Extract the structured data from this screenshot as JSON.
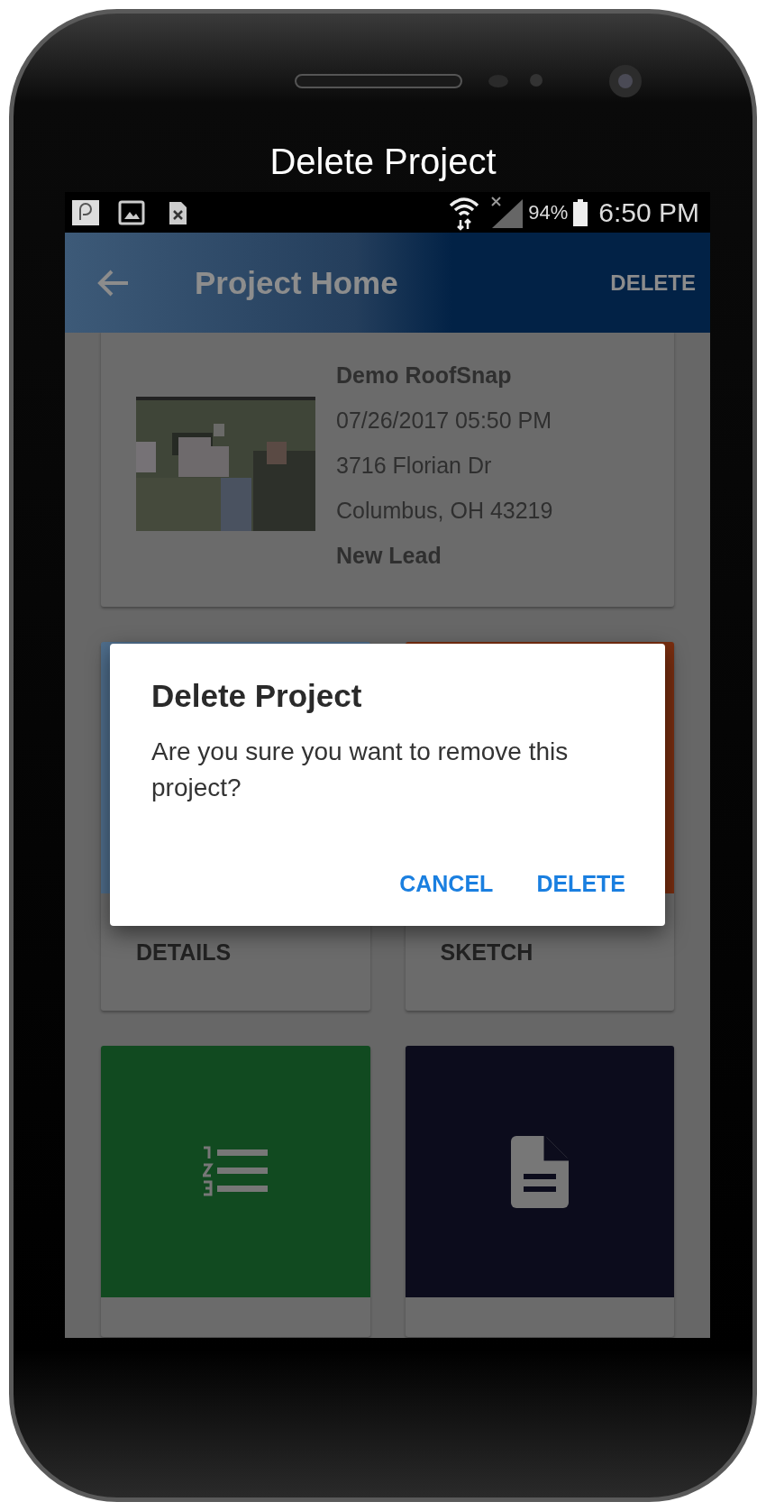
{
  "caption": "Delete Project",
  "status_bar": {
    "battery": "94%",
    "time": "6:50 PM"
  },
  "app_bar": {
    "title": "Project Home",
    "action": "DELETE"
  },
  "project": {
    "name": "Demo RoofSnap",
    "date": "07/26/2017 05:50 PM",
    "address": "3716 Florian Dr",
    "city": "Columbus, OH 43219",
    "status": "New Lead"
  },
  "tiles": [
    {
      "kind": "plain",
      "label": "DETAILS",
      "color": "#4f6e8c"
    },
    {
      "kind": "plain",
      "label": "SKETCH",
      "color": "#7a2e10"
    },
    {
      "kind": "list",
      "color": "#114a20"
    },
    {
      "kind": "document",
      "color": "#0c0c1c"
    }
  ],
  "dialog": {
    "title": "Delete Project",
    "message": "Are you sure you want to remove this project?",
    "buttons": [
      "CANCEL",
      "DELETE"
    ]
  }
}
